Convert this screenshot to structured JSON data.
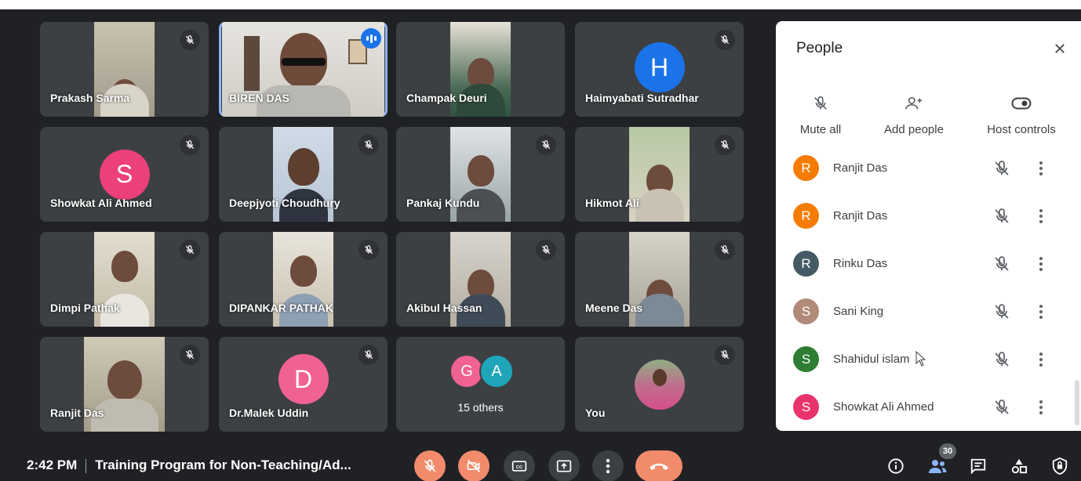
{
  "tiles": [
    {
      "name": "Prakash Sarma"
    },
    {
      "name": "BIREN DAS"
    },
    {
      "name": "Champak Deuri"
    },
    {
      "name": "Haimyabati Sutradhar",
      "avatar_letter": "H"
    },
    {
      "name": "Showkat Ali Ahmed",
      "avatar_letter": "S"
    },
    {
      "name": "Deepjyoti Choudhury"
    },
    {
      "name": "Pankaj Kundu"
    },
    {
      "name": "Hikmot Ali"
    },
    {
      "name": "Dimpi Pathak"
    },
    {
      "name": "DIPANKAR PATHAK"
    },
    {
      "name": "Akibul Hassan"
    },
    {
      "name": "Meene Das"
    },
    {
      "name": "Ranjit Das"
    },
    {
      "name": "Dr.Malek Uddin",
      "avatar_letter": "D"
    },
    {
      "others_letters": [
        "G",
        "A"
      ],
      "others_label": "15 others"
    },
    {
      "name": "You"
    }
  ],
  "colors": {
    "accent": "#1a73e8",
    "speaking_outline": "#8ab4f8",
    "control_red": "#f28b6b",
    "avatar_H": "#1a73e8",
    "avatar_S": "#ec407a",
    "avatar_D": "#f06292",
    "avatar_G": "#f06292",
    "avatar_A": "#1ea6b8"
  },
  "people_panel": {
    "title": "People",
    "actions": [
      {
        "label": "Mute all",
        "icon": "mic-off-icon"
      },
      {
        "label": "Add people",
        "icon": "person-add-icon"
      },
      {
        "label": "Host controls",
        "icon": "toggle-icon"
      }
    ],
    "participants": [
      {
        "initial": "R",
        "name": "Ranjit Das",
        "color": "#f57c00"
      },
      {
        "initial": "R",
        "name": "Ranjit Das",
        "color": "#f57c00"
      },
      {
        "initial": "R",
        "name": "Rinku Das",
        "color": "#455a64"
      },
      {
        "initial": "S",
        "name": "Sani King",
        "color": "#b28a7a"
      },
      {
        "initial": "S",
        "name": "Shahidul islam",
        "color": "#2e7d32"
      },
      {
        "initial": "S",
        "name": "Showkat Ali Ahmed",
        "color": "#e8336d"
      }
    ]
  },
  "bottom_bar": {
    "time": "2:42 PM",
    "meeting_title": "Training Program for Non-Teaching/Ad...",
    "participant_count": "30"
  }
}
